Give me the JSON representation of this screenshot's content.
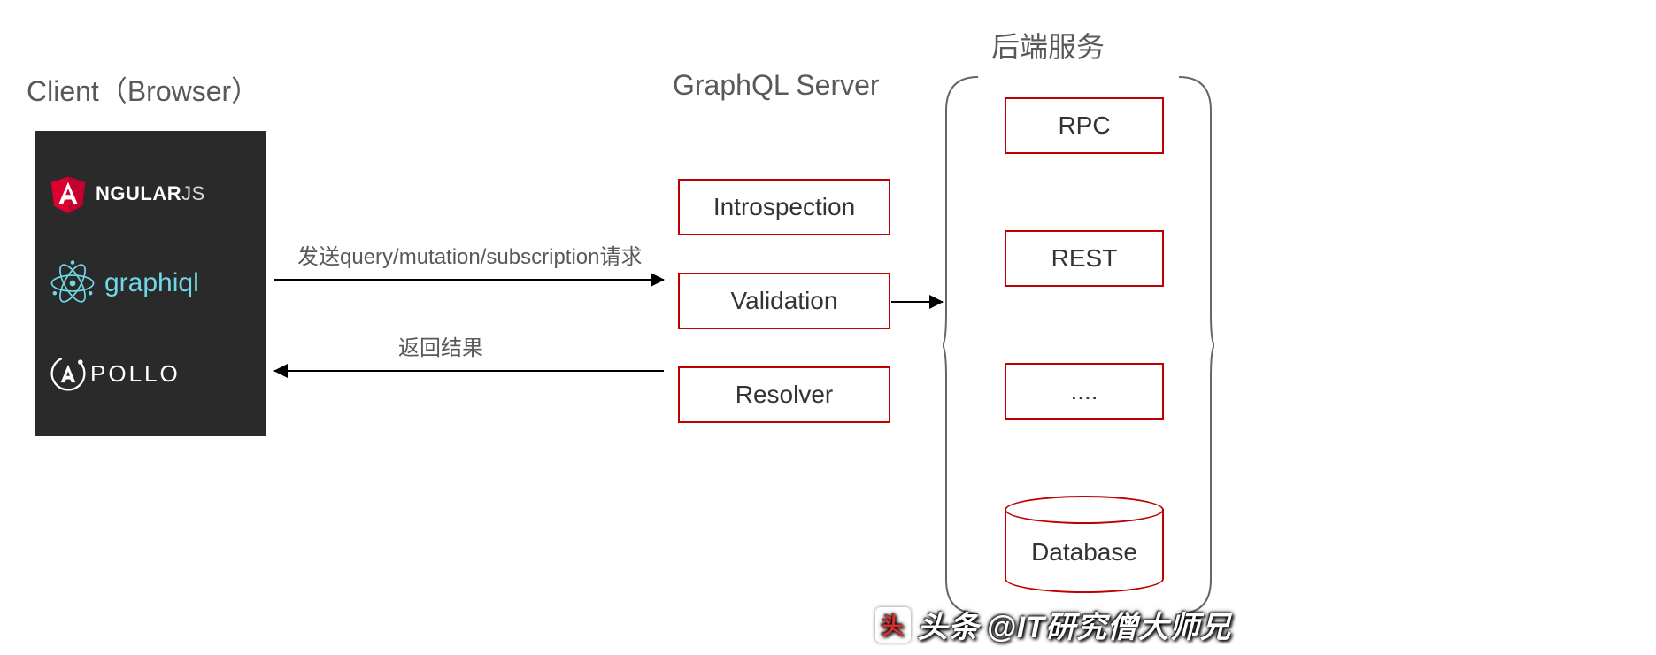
{
  "titles": {
    "client": "Client（Browser）",
    "server": "GraphQL Server",
    "backend": "后端服务"
  },
  "client_stack": {
    "angular_bold": "NGULAR",
    "angular_light": "JS",
    "graphiql": "graphiql",
    "apollo": "POLLO"
  },
  "arrows": {
    "request_label": "发送query/mutation/subscription请求",
    "response_label": "返回结果"
  },
  "server_boxes": [
    "Introspection",
    "Validation",
    "Resolver"
  ],
  "backend_boxes": [
    "RPC",
    "REST",
    "...."
  ],
  "database_label": "Database",
  "watermark": {
    "prefix": "头条",
    "handle": "@IT研究僧大师兄"
  },
  "colors": {
    "box_border": "#c00000",
    "title_text": "#595959",
    "client_bg": "#2a2a2a",
    "graphiql_text": "#6fd7e6"
  }
}
